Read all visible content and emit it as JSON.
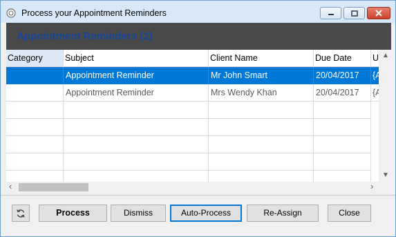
{
  "window": {
    "title": "Process your Appointment Reminders"
  },
  "header": {
    "title": "Appointment Reminders (2)"
  },
  "grid": {
    "columns": [
      "Category",
      "Subject",
      "Client Name",
      "Due Date",
      "U"
    ],
    "rows": [
      {
        "category": "",
        "subject": "Appointment Reminder",
        "client": "Mr John Smart",
        "due": "20/04/2017",
        "extra": "{A"
      },
      {
        "category": "",
        "subject": "Appointment Reminder",
        "client": "Mrs Wendy Khan",
        "due": "20/04/2017",
        "extra": "{A"
      }
    ]
  },
  "buttons": {
    "refresh_icon": "refresh-icon",
    "process": "Process",
    "dismiss": "Dismiss",
    "auto_process": "Auto-Process",
    "re_assign": "Re-Assign",
    "close": "Close"
  },
  "colors": {
    "selection": "#0078d7",
    "header_band": "#4a4a4a",
    "header_text": "#16479a"
  }
}
